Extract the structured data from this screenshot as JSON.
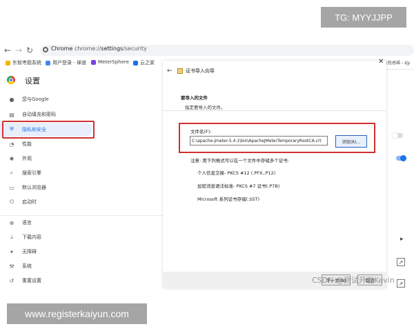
{
  "tg_badge": "TG: MYYJJPP",
  "url_badge": "www.registerkaiyun.com",
  "browser": {
    "site_label": "Chrome",
    "url_prefix": "chrome://",
    "url_path": "settings",
    "url_suffix": "/security"
  },
  "bookmarks": [
    {
      "label": "东软考题系统",
      "icon_color": "#f4b400"
    },
    {
      "label": "用户登录 - 禅道",
      "icon_color": "#4285f4"
    },
    {
      "label": "MeterSphere",
      "icon_color": "#7b3fe4"
    },
    {
      "label": "云之家",
      "icon_color": "#1a73e8"
    }
  ],
  "bookmarks_overflow": "色包总结 - zjy",
  "settings": {
    "title": "设置",
    "items": [
      {
        "label": "您与Google",
        "icon": "person-icon"
      },
      {
        "label": "自动填充和密码",
        "icon": "clipboard-icon"
      },
      {
        "label": "隐私和安全",
        "icon": "shield-icon",
        "active": true
      },
      {
        "label": "性能",
        "icon": "gauge-icon"
      },
      {
        "label": "外观",
        "icon": "palette-icon"
      },
      {
        "label": "搜索引擎",
        "icon": "search-icon"
      },
      {
        "label": "默认浏览器",
        "icon": "browser-icon"
      },
      {
        "label": "启动时",
        "icon": "power-icon"
      },
      {
        "label": "语言",
        "icon": "globe-icon"
      },
      {
        "label": "下载内容",
        "icon": "download-icon"
      },
      {
        "label": "无障碍",
        "icon": "accessibility-icon"
      },
      {
        "label": "系统",
        "icon": "wrench-icon"
      },
      {
        "label": "重置设置",
        "icon": "reset-icon"
      }
    ]
  },
  "dialog": {
    "title": "证书导入向导",
    "heading": "要导入的文件",
    "subheading": "指定要导入的文件。",
    "file_label": "文件名(F):",
    "file_value": "C:\\apache-jmeter-5.4.1\\bin\\ApacheJMeterTemporaryRootCA.crt",
    "browse_label": "浏览(R)...",
    "note": "注意: 用下列格式可以在一个文件中存储多个证书:",
    "formats": [
      "个人信息交换- PKCS #12 (.PFX,.P12)",
      "加密消息语法标准- PKCS #7 证书(.P7B)",
      "Microsoft 系列证书存储(.SST)"
    ],
    "next_label": "下一步(N)",
    "cancel_label": "取消"
  },
  "watermark": "CSDN @测试开发Kevin",
  "colors": {
    "accent": "#1a73e8",
    "highlight_box": "#d03030",
    "active_bg": "#e8eefc"
  }
}
